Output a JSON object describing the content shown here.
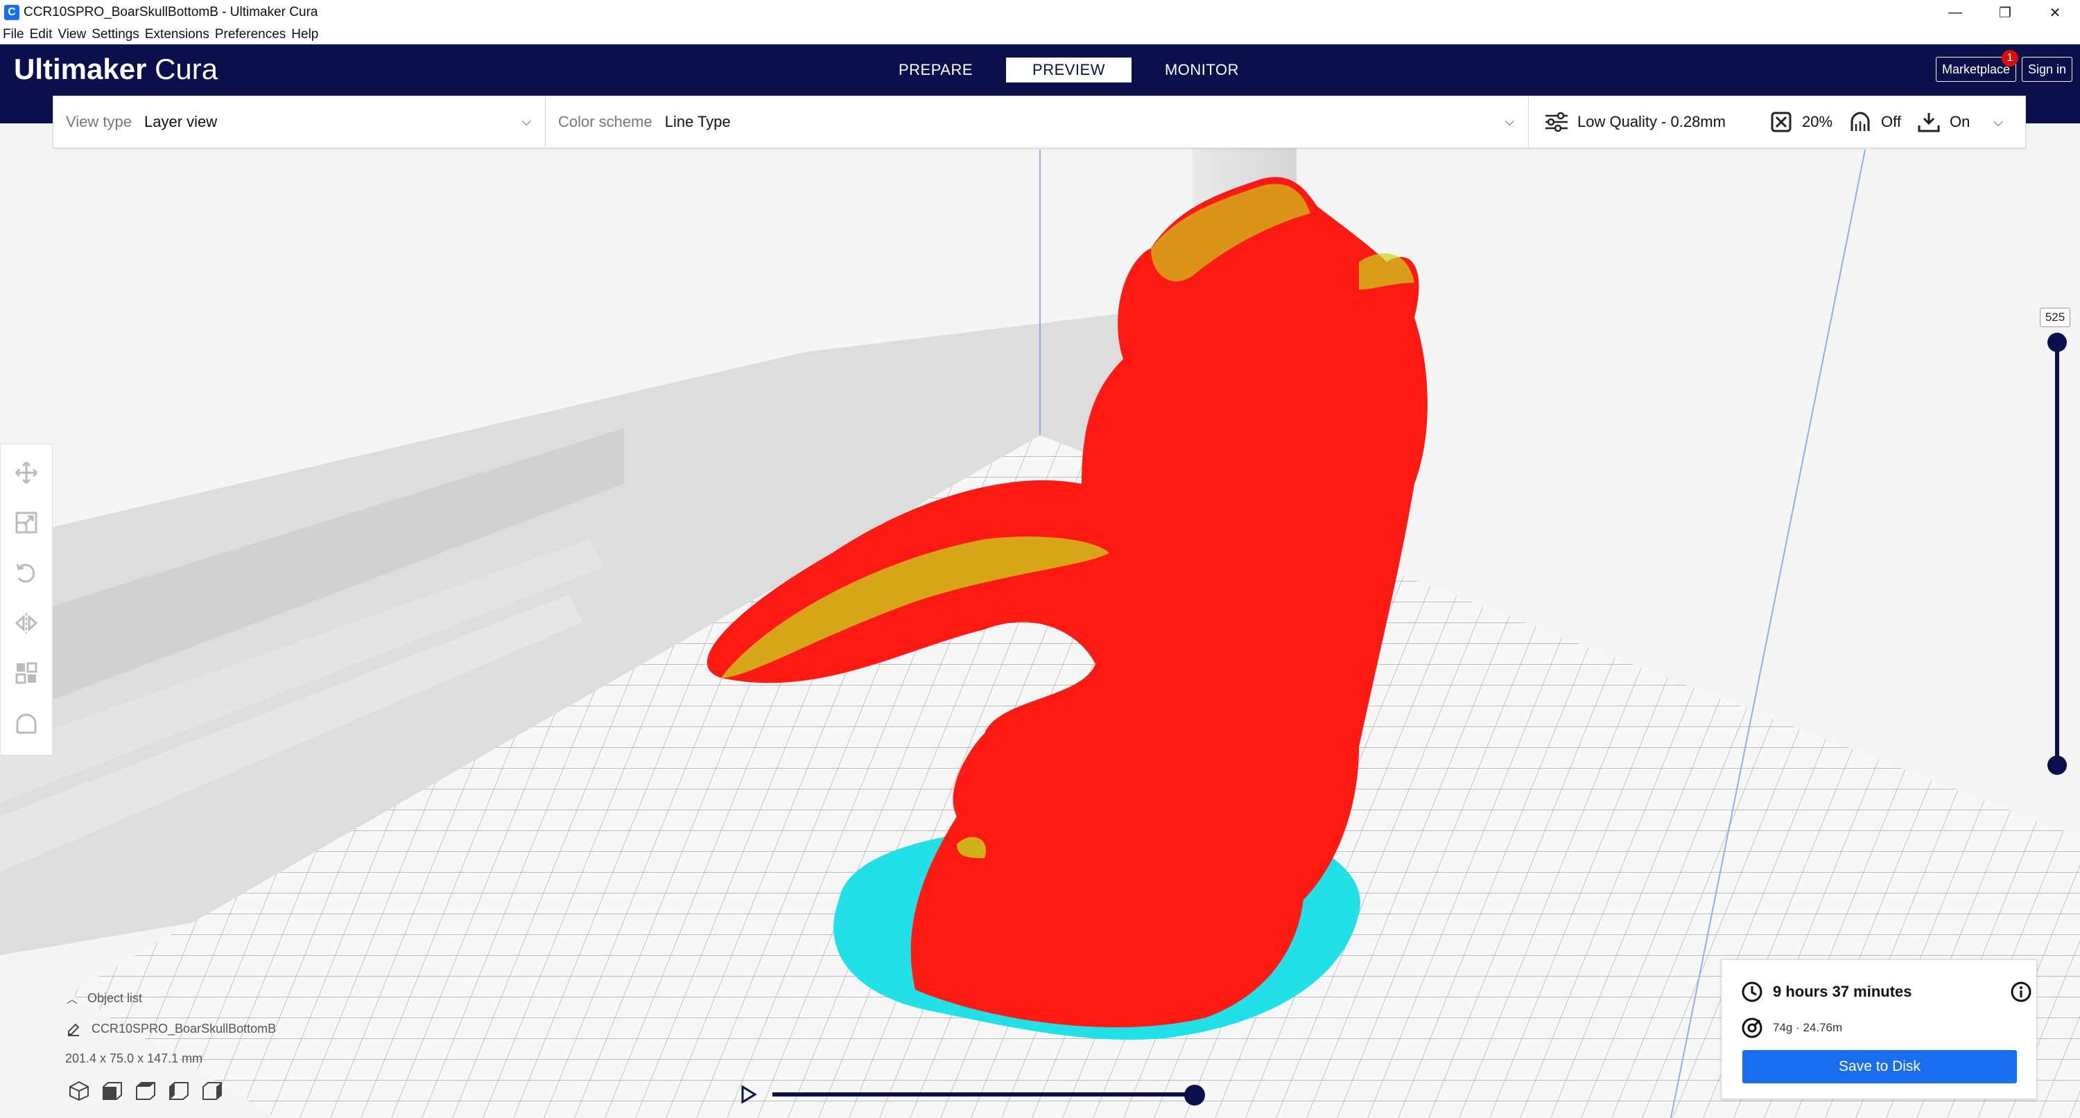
{
  "window": {
    "title": "CCR10SPRO_BoarSkullBottomB - Ultimaker Cura",
    "minimize": "—",
    "restore": "❐",
    "close": "✕"
  },
  "menu": {
    "items": [
      "File",
      "Edit",
      "View",
      "Settings",
      "Extensions",
      "Preferences",
      "Help"
    ]
  },
  "header": {
    "brand_bold": "Ultimaker",
    "brand_light": " Cura",
    "stages": [
      "PREPARE",
      "PREVIEW",
      "MONITOR"
    ],
    "active_stage": "PREVIEW",
    "marketplace_label": "Marketplace",
    "marketplace_badge": "1",
    "signin_label": "Sign in"
  },
  "settings_bar": {
    "view_type_label": "View type",
    "view_type_value": "Layer view",
    "color_scheme_label": "Color scheme",
    "color_scheme_value": "Line Type",
    "quality": "Low Quality - 0.28mm",
    "infill": "20%",
    "support": "Off",
    "adhesion": "On"
  },
  "layer_slider": {
    "current_layer": "525"
  },
  "simulation": {
    "progress": 1.0
  },
  "object_list": {
    "header": "Object list",
    "object_name": "CCR10SPRO_BoarSkullBottomB",
    "dimensions": "201.4 x 75.0 x 147.1 mm"
  },
  "print_info": {
    "time": "9 hours 37 minutes",
    "material": "74g · 24.76m",
    "save_label": "Save to Disk"
  },
  "colors": {
    "header_bg": "#0b0f4b",
    "accent_blue": "#196ef0",
    "model_red": "#ff1a14",
    "model_yellow": "#c8d41a",
    "skirt_cyan": "#22e0e8",
    "badge_red": "#d90f0f"
  }
}
